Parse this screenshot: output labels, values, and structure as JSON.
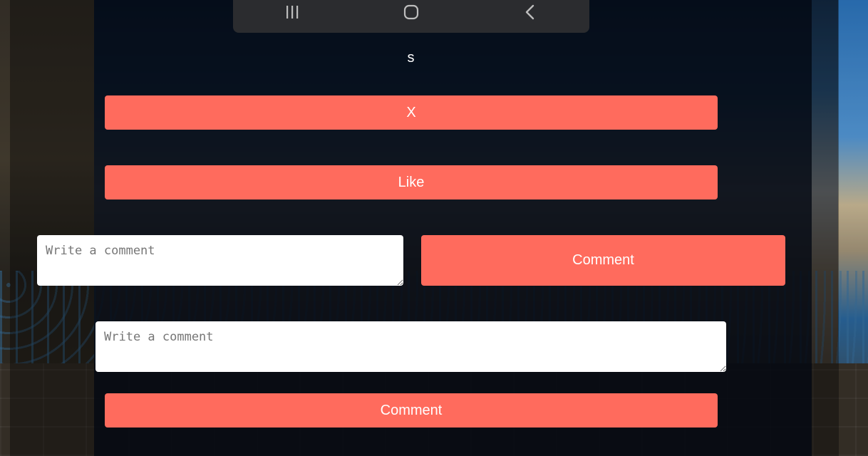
{
  "android_nav": {
    "icons": [
      "recent-apps-icon",
      "home-icon",
      "back-icon"
    ]
  },
  "post": {
    "title": "s"
  },
  "buttons": {
    "close_label": "X",
    "like_label": "Like",
    "comment_label_1": "Comment",
    "comment_label_2": "Comment"
  },
  "comment_inputs": {
    "placeholder_1": "Write a comment",
    "placeholder_2": "Write a comment",
    "value_1": "",
    "value_2": ""
  },
  "colors": {
    "accent": "#ff6b5d",
    "panel": "#03081a",
    "nav_bar": "#2b2c2f"
  }
}
